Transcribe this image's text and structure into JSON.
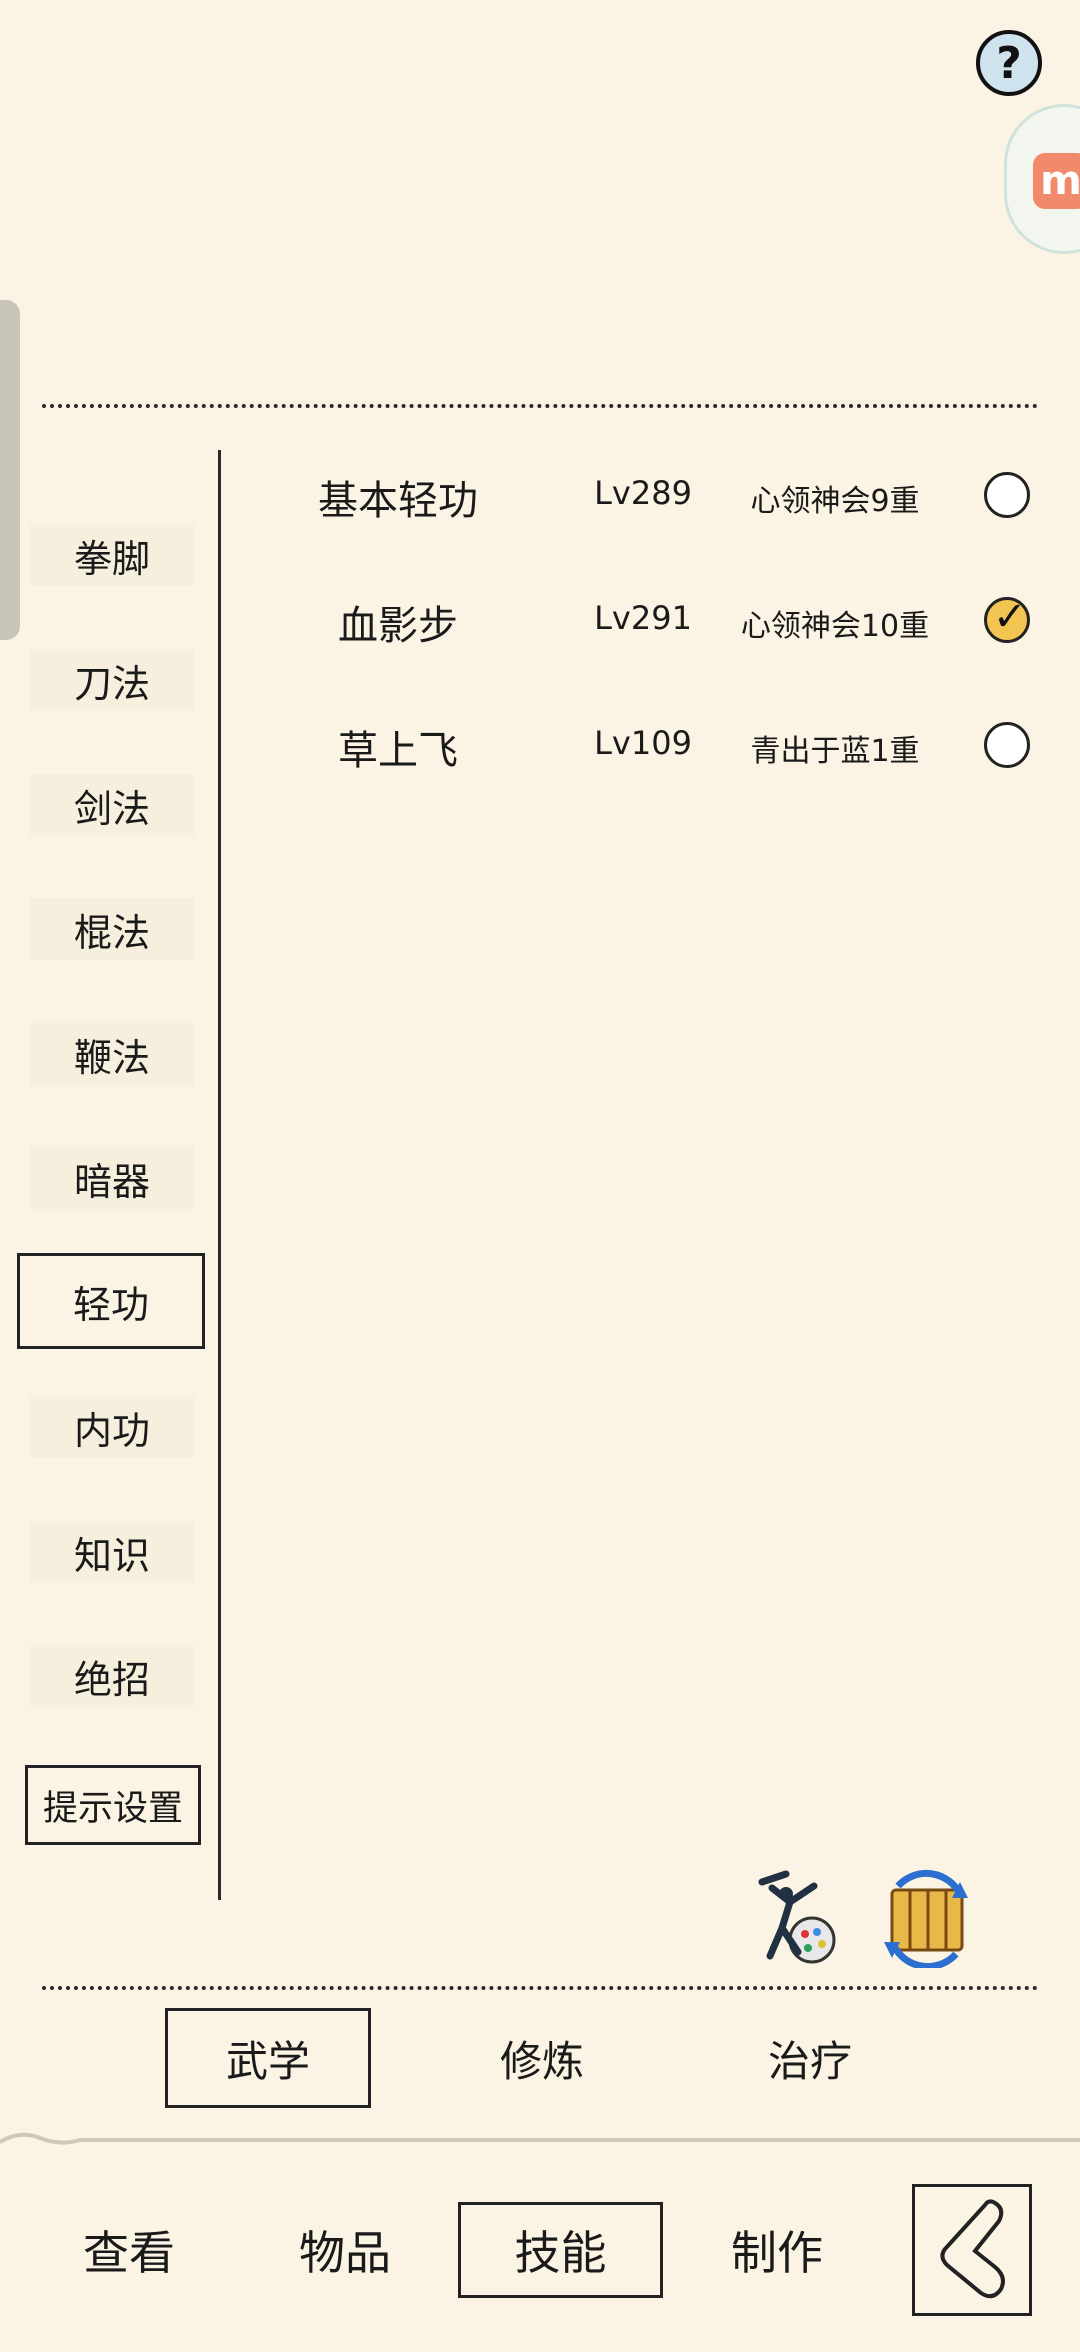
{
  "top": {
    "help_symbol": "?",
    "float_logo": "m"
  },
  "categories": [
    {
      "label": "拳脚"
    },
    {
      "label": "刀法"
    },
    {
      "label": "剑法"
    },
    {
      "label": "棍法"
    },
    {
      "label": "鞭法"
    },
    {
      "label": "暗器"
    },
    {
      "label": "轻功"
    },
    {
      "label": "内功"
    },
    {
      "label": "知识"
    },
    {
      "label": "绝招"
    }
  ],
  "selected_category": "轻功",
  "hint_settings_label": "提示设置",
  "skills": [
    {
      "name": "基本轻功",
      "level": "Lv289",
      "state": "心领神会9重",
      "checked": false
    },
    {
      "name": "血影步",
      "level": "Lv291",
      "state": "心领神会10重",
      "checked": true
    },
    {
      "name": "草上飞",
      "level": "Lv109",
      "state": "青出于蓝1重",
      "checked": false
    }
  ],
  "sub_tabs": [
    {
      "label": "武学"
    },
    {
      "label": "修炼"
    },
    {
      "label": "治疗"
    }
  ],
  "selected_sub_tab": "武学",
  "nav": [
    {
      "label": "查看"
    },
    {
      "label": "物品"
    },
    {
      "label": "技能"
    },
    {
      "label": "制作"
    }
  ],
  "selected_nav": "技能",
  "icons": {
    "help": "question-icon",
    "float": "app-logo-icon",
    "martial": "martial-artist-icon",
    "swap": "scroll-swap-icon",
    "back": "back-arrow-icon",
    "check": "checkmark-icon"
  },
  "colors": {
    "background": "#fbf4e4",
    "radio_checked": "#f2c552",
    "help_bg": "#cfe3ef"
  }
}
